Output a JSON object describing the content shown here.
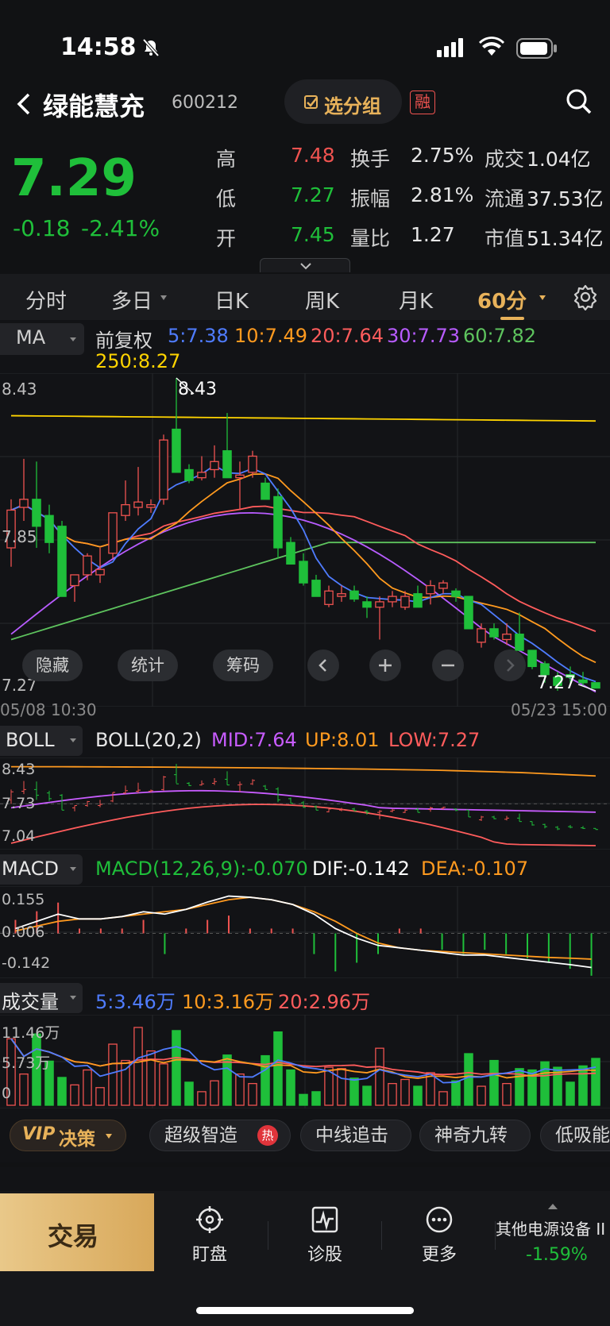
{
  "status": {
    "time": "14:58"
  },
  "header": {
    "name": "绿能慧充",
    "code": "600212",
    "group_btn": "选分组",
    "margin_tag": "融"
  },
  "quote": {
    "price": "7.29",
    "change": "-0.18",
    "change_pct": "-2.41%",
    "rows": [
      {
        "l1": "高",
        "v1": "7.48",
        "l2": "换手",
        "v2": "2.75%",
        "l3": "成交",
        "v3": "1.04亿"
      },
      {
        "l1": "低",
        "v1": "7.27",
        "l2": "振幅",
        "v2": "2.81%",
        "l3": "流通",
        "v3": "37.53亿"
      },
      {
        "l1": "开",
        "v1": "7.45",
        "l2": "量比",
        "v2": "1.27",
        "l3": "市值",
        "v3": "51.34亿"
      }
    ]
  },
  "tabs": [
    "分时",
    "多日",
    "日K",
    "周K",
    "月K",
    "60分"
  ],
  "active_tab": "60分",
  "ma": {
    "label": "MA",
    "adjust": "前复权",
    "ma5": "5:7.38",
    "ma10": "10:7.49",
    "ma20": "20:7.64",
    "ma30": "30:7.73",
    "ma60": "60:7.82",
    "ma250": "250:8.27",
    "y_top": "8.43",
    "y_mid": "7.85",
    "y_bot": "7.27",
    "hi_label": "8.43",
    "lo_label": "7.27",
    "date_start": "05/08 10:30",
    "date_end": "05/23 15:00",
    "buttons": [
      "隐藏",
      "统计",
      "筹码"
    ]
  },
  "boll": {
    "label": "BOLL",
    "params": "BOLL(20,2)",
    "mid": "MID:7.64",
    "up": "UP:8.01",
    "low": "LOW:7.27",
    "y1": "8.43",
    "y2": "7.73",
    "y3": "7.04"
  },
  "macd": {
    "label": "MACD",
    "params": "MACD(12,26,9):-0.070",
    "dif": "DIF:-0.142",
    "dea": "DEA:-0.107",
    "y1": "0.155",
    "y2": "0.006",
    "y3": "-0.142"
  },
  "vol": {
    "label": "成交量",
    "v5": "5:3.46万",
    "v10": "10:3.16万",
    "v20": "20:2.96万",
    "y1": "11.46万",
    "y2": "5.73万",
    "y3": "0"
  },
  "strip": {
    "vip": "VIP",
    "vip_label": "决策",
    "items": [
      "超级智造",
      "中线追击",
      "神奇九转",
      "低吸能"
    ],
    "hot": "热"
  },
  "bottom": {
    "trade": "交易",
    "items": [
      "盯盘",
      "诊股",
      "更多"
    ],
    "sector_name": "其他电源设备 II",
    "sector_pct": "-1.59%"
  },
  "colors": {
    "up": "#ef5350",
    "down": "#1fbf3a",
    "ma5": "#4f7cff",
    "ma10": "#ff9a1f",
    "ma20": "#ff5c5c",
    "ma30": "#b85cff",
    "ma60": "#5ec45e",
    "ma250": "#ffd400",
    "gold": "#e8b25a"
  },
  "chart_data": {
    "type": "candlestick",
    "title": "",
    "ylim": [
      7.27,
      8.43
    ],
    "candles": [
      [
        7.8,
        7.98,
        7.73,
        7.94
      ],
      [
        7.95,
        8.13,
        7.9,
        7.98
      ],
      [
        7.98,
        8.12,
        7.8,
        7.88
      ],
      [
        7.92,
        7.96,
        7.78,
        7.82
      ],
      [
        7.88,
        7.9,
        7.62,
        7.62
      ],
      [
        7.66,
        7.7,
        7.6,
        7.7
      ],
      [
        7.7,
        7.78,
        7.68,
        7.77
      ],
      [
        7.7,
        7.8,
        7.67,
        7.72
      ],
      [
        7.78,
        7.93,
        7.76,
        7.93
      ],
      [
        7.92,
        8.05,
        7.9,
        7.96
      ],
      [
        7.95,
        8.1,
        7.92,
        7.97
      ],
      [
        7.95,
        7.98,
        7.93,
        7.96
      ],
      [
        7.98,
        8.22,
        7.96,
        8.2
      ],
      [
        8.24,
        8.43,
        8.09,
        8.08
      ],
      [
        8.09,
        8.11,
        8.04,
        8.05
      ],
      [
        8.06,
        8.14,
        8.05,
        8.08
      ],
      [
        8.09,
        8.18,
        8.06,
        8.12
      ],
      [
        8.16,
        8.3,
        8.06,
        8.06
      ],
      [
        8.06,
        8.12,
        7.94,
        8.07
      ],
      [
        8.08,
        8.16,
        8.06,
        8.14
      ],
      [
        8.04,
        8.06,
        7.98,
        7.98
      ],
      [
        7.99,
        8.02,
        7.76,
        7.8
      ],
      [
        7.82,
        7.84,
        7.74,
        7.74
      ],
      [
        7.75,
        7.78,
        7.66,
        7.67
      ],
      [
        7.68,
        7.7,
        7.62,
        7.62
      ],
      [
        7.59,
        7.66,
        7.58,
        7.64
      ],
      [
        7.62,
        7.66,
        7.6,
        7.63
      ],
      [
        7.64,
        7.66,
        7.6,
        7.61
      ],
      [
        7.6,
        7.62,
        7.54,
        7.58
      ],
      [
        7.58,
        7.62,
        7.46,
        7.6
      ],
      [
        7.6,
        7.64,
        7.58,
        7.62
      ],
      [
        7.58,
        7.64,
        7.57,
        7.62
      ],
      [
        7.63,
        7.66,
        7.58,
        7.58
      ],
      [
        7.63,
        7.68,
        7.59,
        7.66
      ],
      [
        7.65,
        7.68,
        7.63,
        7.67
      ],
      [
        7.64,
        7.65,
        7.6,
        7.62
      ],
      [
        7.62,
        7.62,
        7.5,
        7.5
      ],
      [
        7.45,
        7.52,
        7.43,
        7.5
      ],
      [
        7.5,
        7.52,
        7.46,
        7.47
      ],
      [
        7.46,
        7.52,
        7.44,
        7.48
      ],
      [
        7.48,
        7.56,
        7.42,
        7.42
      ],
      [
        7.42,
        7.42,
        7.35,
        7.36
      ],
      [
        7.37,
        7.38,
        7.3,
        7.33
      ],
      [
        7.32,
        7.34,
        7.27,
        7.29
      ],
      [
        7.33,
        7.36,
        7.3,
        7.32
      ],
      [
        7.31,
        7.34,
        7.29,
        7.3
      ],
      [
        7.3,
        7.3,
        7.28,
        7.28
      ]
    ],
    "volume": [
      9.8,
      4.6,
      10.5,
      6.5,
      4.1,
      3.0,
      5.2,
      2.6,
      9.0,
      6.6,
      11.46,
      8.0,
      6.1,
      11.0,
      3.4,
      2.0,
      3.6,
      7.4,
      4.6,
      3.2,
      7.3,
      10.8,
      5.2,
      1.6,
      2.0,
      5.6,
      5.4,
      4.0,
      2.8,
      8.4,
      3.2,
      3.8,
      2.8,
      4.8,
      2.0,
      3.6,
      7.6,
      2.8,
      6.6,
      3.2,
      5.4,
      5.2,
      6.4,
      5.6,
      3.4,
      5.8,
      6.9
    ],
    "macd_dif": [
      0.02,
      0.05,
      0.08,
      0.06,
      0.06,
      0.07,
      0.09,
      0.08,
      0.1,
      0.13,
      0.155,
      0.15,
      0.14,
      0.12,
      0.08,
      0.02,
      -0.02,
      -0.05,
      -0.06,
      -0.07,
      -0.08,
      -0.09,
      -0.09,
      -0.1,
      -0.11,
      -0.12,
      -0.13,
      -0.142
    ],
    "macd_dea": [
      0.01,
      0.03,
      0.05,
      0.06,
      0.06,
      0.07,
      0.08,
      0.09,
      0.1,
      0.12,
      0.14,
      0.15,
      0.14,
      0.12,
      0.09,
      0.05,
      0.0,
      -0.04,
      -0.06,
      -0.07,
      -0.075,
      -0.08,
      -0.085,
      -0.09,
      -0.095,
      -0.1,
      -0.103,
      -0.107
    ]
  }
}
